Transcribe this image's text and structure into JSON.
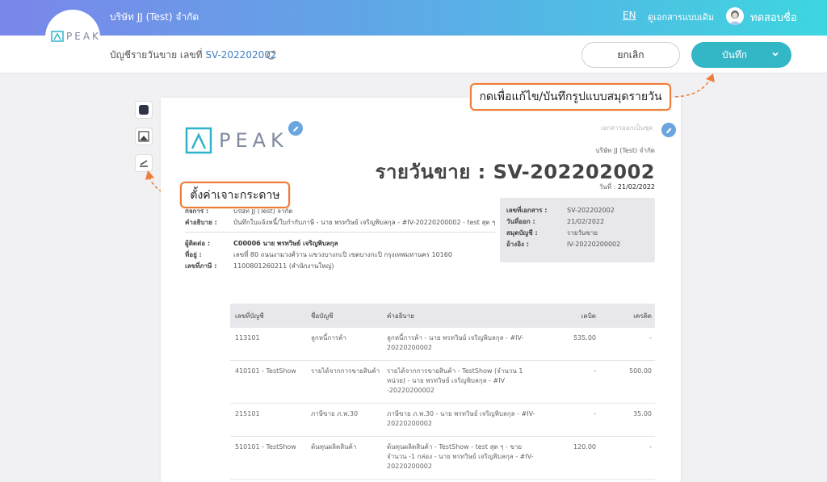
{
  "header": {
    "brand": "PEAK",
    "company": "บริษัท JJ (Test) จำกัด",
    "lang": "EN",
    "old_view": "ดูเอกสารแบบเดิม",
    "username": "ทดสอบชื่อ"
  },
  "subheader": {
    "breadcrumb_label": "บัญชีรายวันขาย เลขที่",
    "doc_number": "SV-202202002",
    "cancel_label": "ยกเลิก",
    "save_label": "บันทึก"
  },
  "callouts": {
    "save_hint": "กดเพื่อแก้ไข/บันทึกรูปแบบสมุดรายวัน",
    "paper_hint": "ตั้งค่าเจาะกระดาษ"
  },
  "document": {
    "brand": "PEAK",
    "original_label": "เอกสารออกเป็นชุด",
    "company": "บริษัท JJ (Test) จำกัด",
    "title": "รายวันขาย : SV-202202002",
    "date_label": "วันที่ :",
    "date_value": "21/02/2022",
    "left": {
      "company_label": "กิจการ :",
      "company_value": "บริษัท JJ (Test) จำกัด",
      "desc_label": "คำอธิบาย :",
      "desc_value": "บันทึกใบแจ้งหนี้/ใบกำกับภาษี - นาย พรทวิษย์ เจริญพิบลกุล - #IV-20220200002 - test สุด ๆ",
      "contact_label": "ผู้ติดต่อ :",
      "contact_value": "C00006 นาย พรทวิษย์ เจริญพิบลกุล",
      "address_label": "ที่อยู่ :",
      "address_value": "เลขที่ 80 ถนนงามวงศ์วาน แขวงบางกะปิ เขตบางกะปิ กรุงเทพมหานคร 10160",
      "tax_label": "เลขที่ภาษี :",
      "tax_value": "1100801260211 (สำนักงานใหญ่)"
    },
    "box": {
      "docno_label": "เลขที่เอกสาร :",
      "docno_value": "SV-202202002",
      "issue_label": "วันที่ออก :",
      "issue_value": "21/02/2022",
      "book_label": "สมุดบัญชี :",
      "book_value": "รายวันขาย",
      "ref_label": "อ้างอิง :",
      "ref_value": "IV-20220200002"
    },
    "table": {
      "headers": [
        "เลขที่บัญชี",
        "ชื่อบัญชี",
        "คำอธิบาย",
        "เดบิต",
        "เครดิต"
      ],
      "rows": [
        [
          "113101",
          "ลูกหนี้การค้า",
          "ลูกหนี้การค้า - นาย พรทวิษย์ เจริญพิบลกุล - #IV-20220200002",
          "535.00",
          "-"
        ],
        [
          "410101 - TestShow",
          "รายได้จากการขายสินค้า",
          "รายได้จากการขายสินค้า - TestShow (จำนวน 1 หน่วย) - นาย พรทวิษย์ เจริญพิบลกุล - #IV -20220200002",
          "-",
          "500.00"
        ],
        [
          "215101",
          "ภาษีขาย ภ.พ.30",
          "ภาษีขาย ภ.พ.30 - นาย พรทวิษย์ เจริญพิบลกุล - #IV-20220200002",
          "-",
          "35.00"
        ],
        [
          "510101 - TestShow",
          "ต้นทุนผลิตสินค้า",
          "ต้นทุนผลิตสินค้า - TestShow - test สุด ๆ - ขาย จำนวน -1 กล่อง - นาย พรทวิษย์ เจริญพิบลกุล - #IV-20220200002",
          "120.00",
          "-"
        ]
      ]
    }
  },
  "colors": {
    "accent": "#33b7c6",
    "link": "#3f7dc4",
    "callout_border": "#ef7d3a"
  }
}
